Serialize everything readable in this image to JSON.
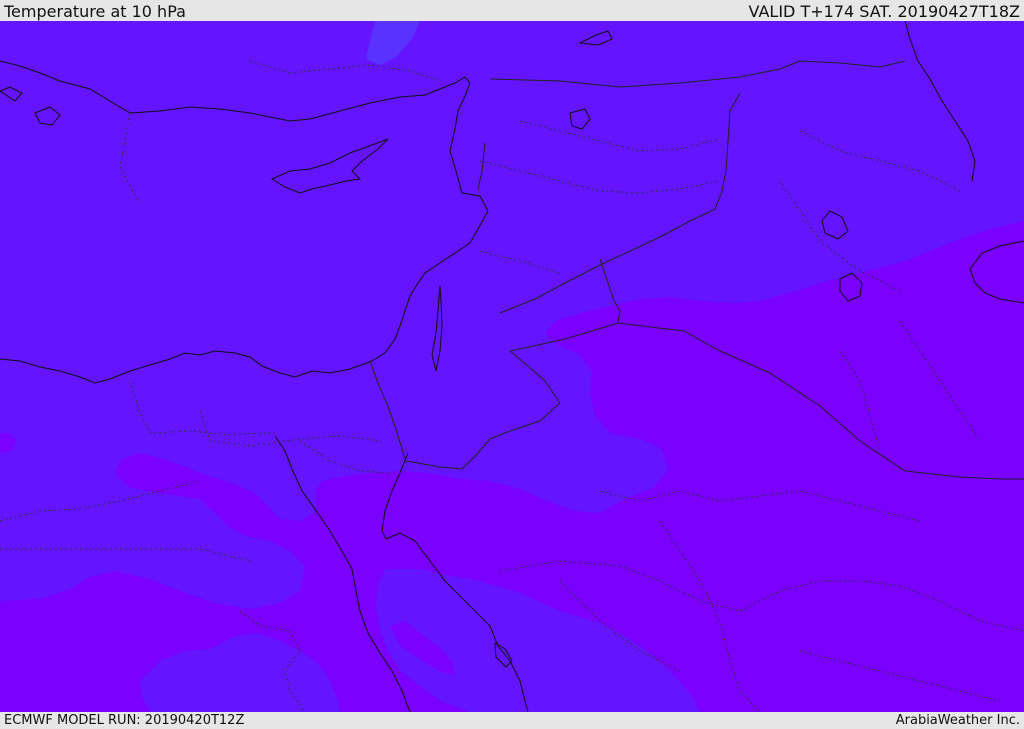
{
  "header": {
    "title": "Temperature at 10 hPa",
    "valid": "VALID T+174 SAT. 20190427T18Z"
  },
  "footer": {
    "model_run": "ECMWF MODEL RUN: 20190420T12Z",
    "credit": "ArabiaWeather Inc."
  },
  "map": {
    "colors": {
      "cold_band": "#6414ff",
      "warm_band": "#7a00ff",
      "cold_patch": "#5a32ff",
      "coastline": "#111111",
      "border": "#333333"
    }
  }
}
